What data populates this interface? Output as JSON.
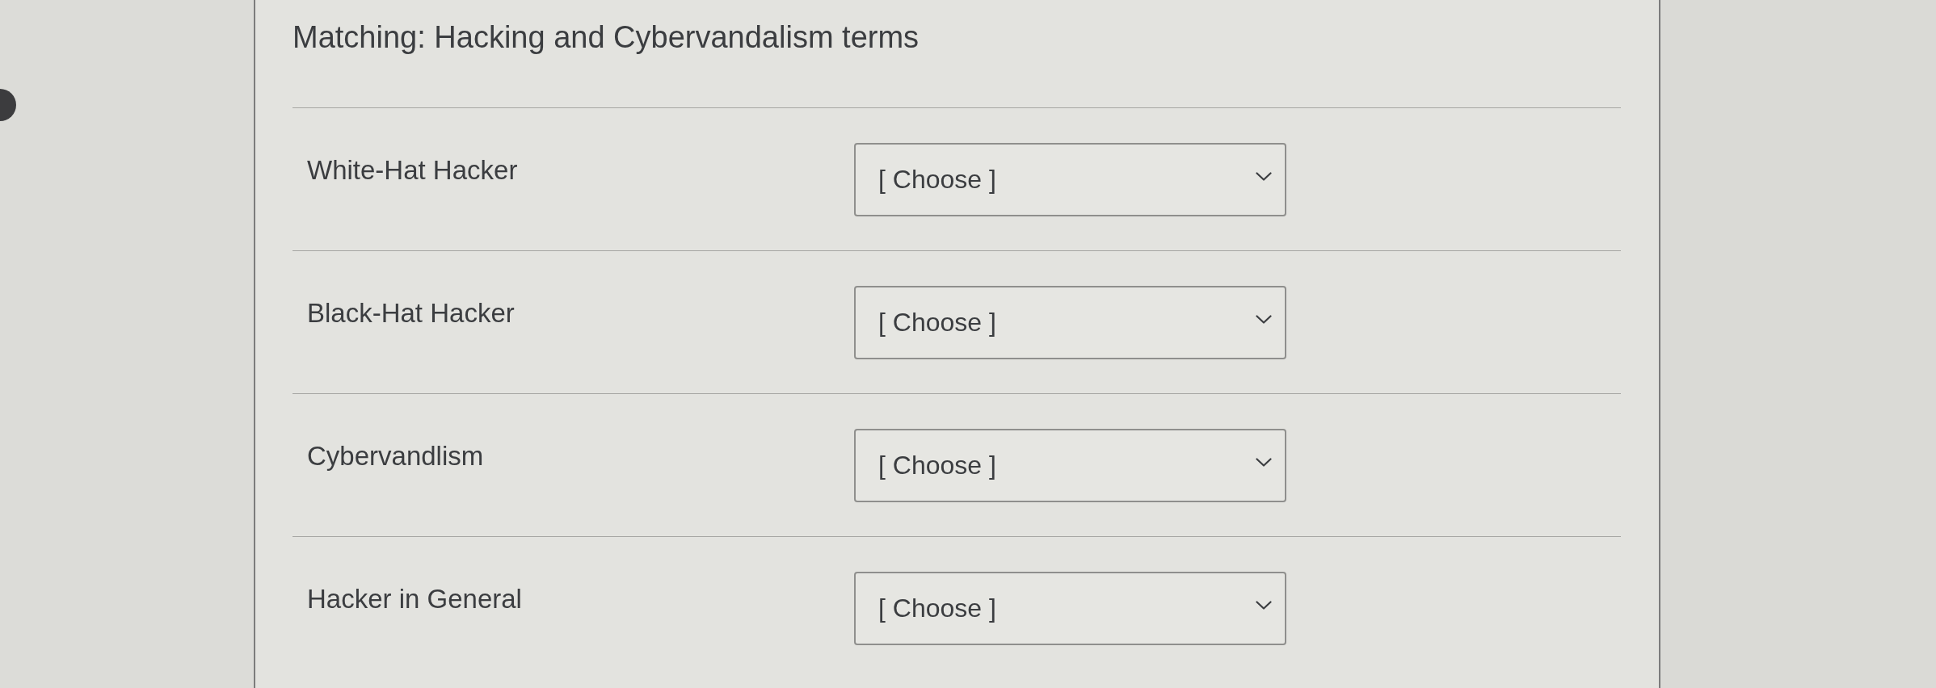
{
  "title": "Matching: Hacking and Cybervandalism terms",
  "items": [
    {
      "term": "White-Hat Hacker",
      "answer": {
        "value": "[ Choose ]"
      }
    },
    {
      "term": "Black-Hat Hacker",
      "answer": {
        "value": "[ Choose ]"
      }
    },
    {
      "term": "Cybervandlism",
      "answer": {
        "value": "[ Choose ]"
      }
    },
    {
      "term": "Hacker in General",
      "answer": {
        "value": "[ Choose ]"
      }
    }
  ]
}
